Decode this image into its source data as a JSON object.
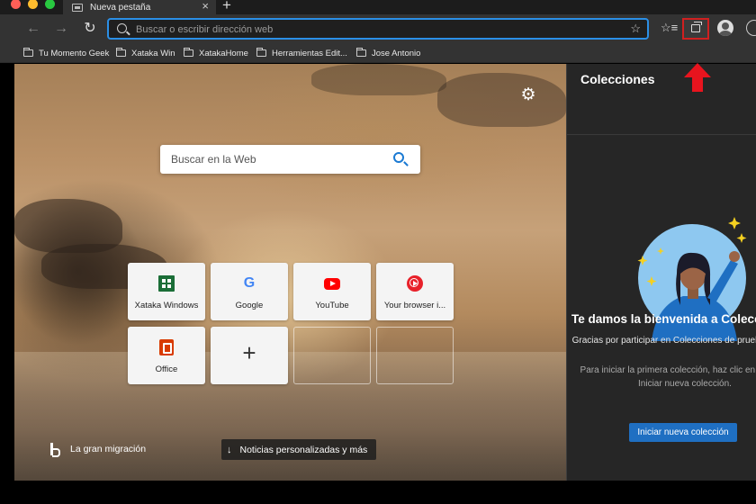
{
  "browser": {
    "tab": {
      "title": "Nueva pestaña",
      "close": "×",
      "new_tab": "+"
    },
    "toolbar": {
      "back": "←",
      "forward": "→",
      "reload": "↻",
      "address_placeholder": "Buscar o escribir dirección web",
      "favorite": "☆",
      "favorites_list": "☆≡"
    },
    "bookmarks": [
      {
        "label": "Tu Momento Geek"
      },
      {
        "label": "Xataka Win"
      },
      {
        "label": "XatakaHome"
      },
      {
        "label": "Herramientas Edit..."
      },
      {
        "label": "Jose Antonio"
      }
    ]
  },
  "new_tab_page": {
    "settings_icon": "⚙",
    "search_placeholder": "Buscar en la Web",
    "quick_links": [
      {
        "label": "Xataka Windows",
        "icon": "xataka-windows-icon"
      },
      {
        "label": "Google",
        "icon": "google-icon"
      },
      {
        "label": "YouTube",
        "icon": "youtube-icon"
      },
      {
        "label": "Your browser i...",
        "icon": "your-browser-icon"
      },
      {
        "label": "Office",
        "icon": "office-icon"
      },
      {
        "label": "+",
        "icon": "add-icon"
      }
    ],
    "google_glyph": "G",
    "image_credit": "La gran migración",
    "news_button": "Noticias personalizadas y más",
    "news_arrow": "↓"
  },
  "collections_pane": {
    "title": "Colecciones",
    "welcome": "Te damos la bienvenida a Colecciones",
    "thanks": "Gracias por participar en Colecciones de prueba interna.",
    "hint": "Para iniciar la primera colección, haz clic en el botón Iniciar nueva colección.",
    "start_button": "Iniciar nueva colección"
  },
  "colors": {
    "accent": "#2b8fe6",
    "annotation_red": "#e8141e",
    "pane_background": "#262626",
    "start_button": "#1f6fc2"
  }
}
